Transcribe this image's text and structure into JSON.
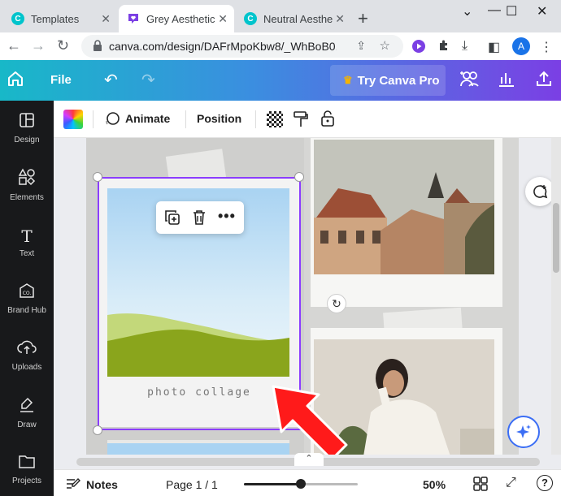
{
  "browser": {
    "tabs": [
      {
        "title": "Templates",
        "active": false
      },
      {
        "title": "Grey Aesthetic",
        "active": true
      },
      {
        "title": "Neutral Aesthe",
        "active": false
      }
    ],
    "url": "canva.com/design/DAFrMpoKbw8/_WhBoB0...",
    "profile_initial": "A"
  },
  "canva_header": {
    "file_label": "File",
    "try_pro_label": "Try Canva Pro"
  },
  "sidebar": {
    "items": [
      {
        "label": "Design",
        "icon": "design-icon"
      },
      {
        "label": "Elements",
        "icon": "elements-icon"
      },
      {
        "label": "Text",
        "icon": "text-icon"
      },
      {
        "label": "Brand Hub",
        "icon": "brand-hub-icon"
      },
      {
        "label": "Uploads",
        "icon": "uploads-icon"
      },
      {
        "label": "Draw",
        "icon": "draw-icon"
      },
      {
        "label": "Projects",
        "icon": "projects-icon"
      }
    ]
  },
  "toolbar": {
    "animate_label": "Animate",
    "position_label": "Position"
  },
  "canvas": {
    "caption": "photo collage"
  },
  "bottom_bar": {
    "notes_label": "Notes",
    "page_label": "Page 1 / 1",
    "zoom_label": "50%",
    "zoom_level": 0.5,
    "help_label": "?"
  },
  "colors": {
    "selection": "#8b3dff",
    "arrow": "#ff1a1a",
    "sidebar_bg": "#18191b"
  }
}
